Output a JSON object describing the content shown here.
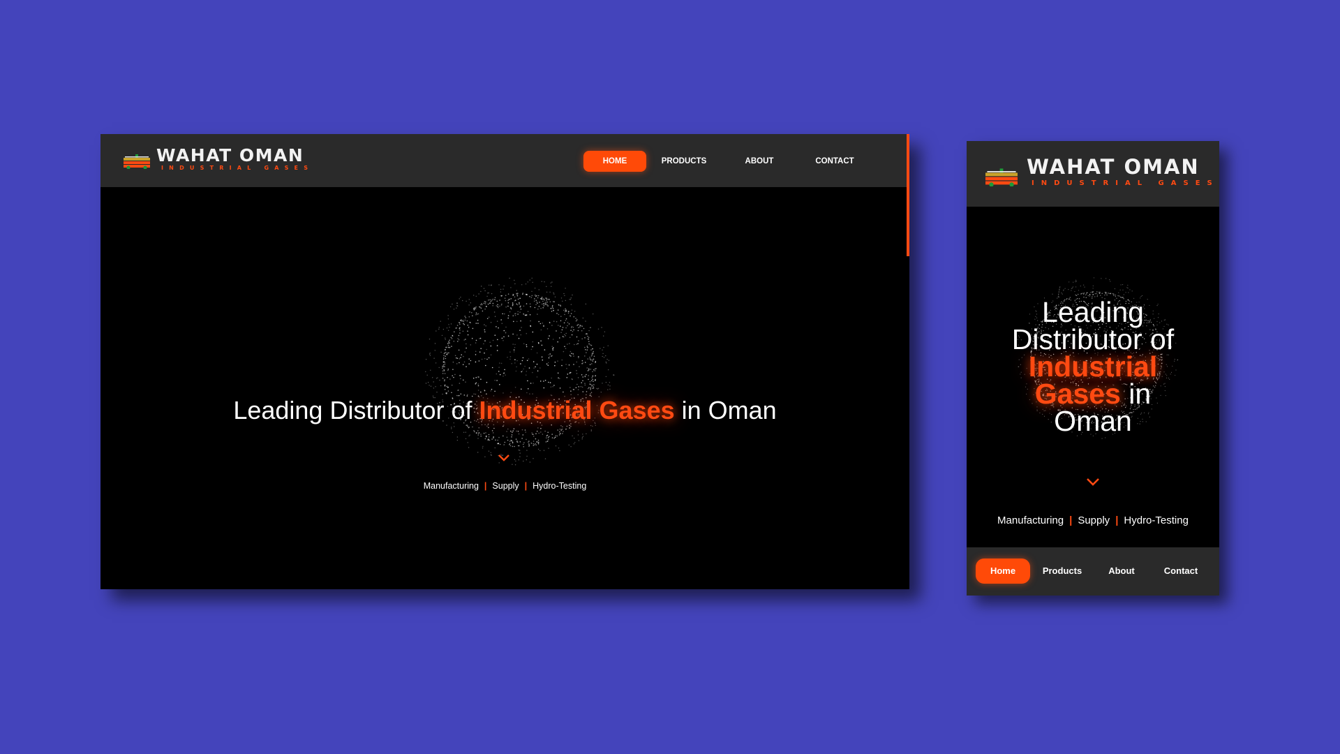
{
  "brand": {
    "name": "WAHAT OMAN",
    "tagline": "INDUSTRIAL GASES",
    "accent_color": "#ff4a12",
    "background_color": "#4444bb"
  },
  "desktop": {
    "nav": [
      {
        "label": "HOME",
        "active": true
      },
      {
        "label": "PRODUCTS",
        "active": false
      },
      {
        "label": "ABOUT",
        "active": false
      },
      {
        "label": "CONTACT",
        "active": false
      }
    ],
    "hero": {
      "headline_before": "Leading Distributor of ",
      "headline_accent": "Industrial Gases",
      "headline_after": " in Oman",
      "scroll_icon": "chevron-down-icon"
    },
    "services": [
      "Manufacturing",
      "Supply",
      "Hydro-Testing"
    ]
  },
  "mobile": {
    "hero": {
      "line1": "Leading",
      "line2": "Distributor of",
      "accent_line1": "Industrial",
      "accent_line2": "Gases",
      "after_accent": " in",
      "line_last": "Oman"
    },
    "services": [
      "Manufacturing",
      "Supply",
      "Hydro-Testing"
    ],
    "bottom_nav": [
      {
        "label": "Home",
        "active": true
      },
      {
        "label": "Products",
        "active": false
      },
      {
        "label": "About",
        "active": false
      },
      {
        "label": "Contact",
        "active": false
      }
    ]
  }
}
